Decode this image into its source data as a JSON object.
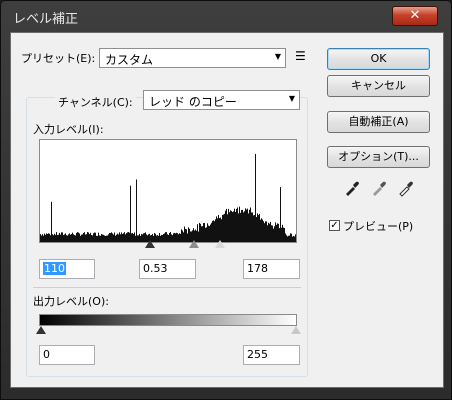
{
  "window": {
    "title": "レベル補正",
    "close_glyph": "✕"
  },
  "preset": {
    "label": "プリセット(E):",
    "value": "カスタム",
    "menu_glyph": "☰"
  },
  "channel": {
    "label": "チャンネル(C):",
    "value": "レッド のコピー"
  },
  "input_levels": {
    "label": "入力レベル(I):",
    "black": "110",
    "gamma": "0.53",
    "white": "178",
    "black_fraction": 0.43,
    "gamma_fraction": 0.6,
    "white_fraction": 0.7
  },
  "output_levels": {
    "label": "出力レベル(O):",
    "black": "0",
    "white": "255"
  },
  "buttons": {
    "ok": "OK",
    "cancel": "キャンセル",
    "auto": "自動補正(A)",
    "options": "オプション(T)..."
  },
  "preview": {
    "label": "プレビュー(P)",
    "checked": true,
    "check_glyph": "✓"
  },
  "dropdown_arrow": "▼",
  "colors": {
    "accent": "#3399ff",
    "window_bg": "#f0f0f0",
    "close": "#c7412a"
  }
}
